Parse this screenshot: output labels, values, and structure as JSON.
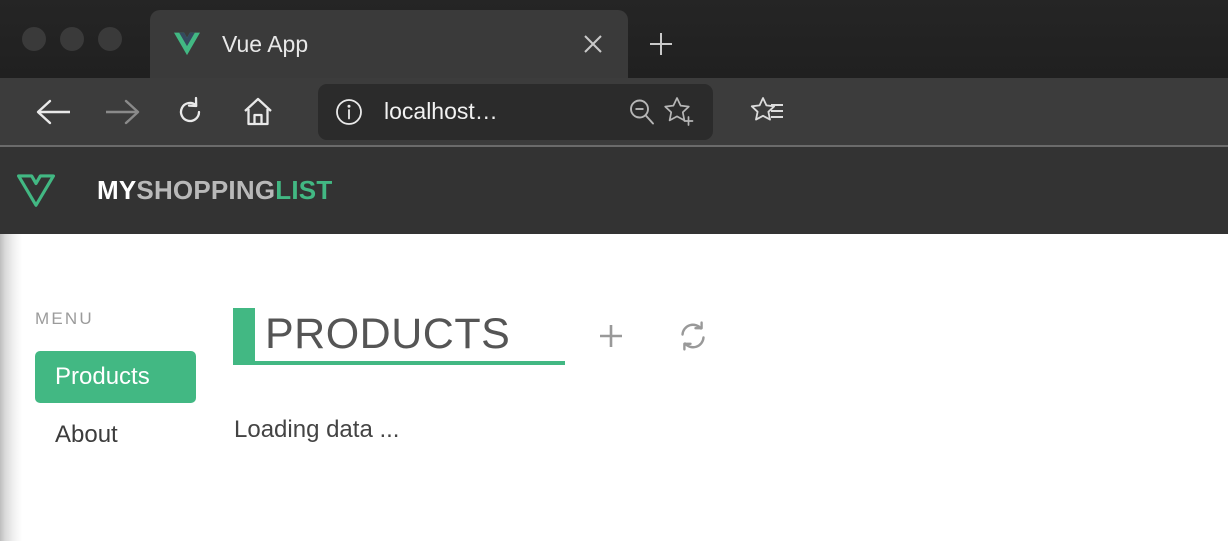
{
  "browser": {
    "window_controls": [
      "close",
      "minimize",
      "maximize"
    ],
    "tab": {
      "title": "Vue App",
      "favicon": "vue-logo-icon",
      "close_label": "×"
    },
    "new_tab_label": "+",
    "toolbar": {
      "back": "back-arrow-icon",
      "forward": "forward-arrow-icon",
      "reload": "reload-icon",
      "home": "home-icon",
      "url_info": "info-circle-icon",
      "url_text": "localhost…",
      "zoom_out": "zoom-out-icon",
      "bookmark_add": "star-plus-icon",
      "reading_list": "reading-list-icon"
    }
  },
  "app": {
    "logo": "vue-logo-icon",
    "brand": {
      "part1": "MY",
      "part2": "SHOPPING",
      "part3": "LIST"
    }
  },
  "sidebar": {
    "heading": "MENU",
    "items": [
      {
        "label": "Products",
        "active": true
      },
      {
        "label": "About",
        "active": false
      }
    ]
  },
  "main": {
    "title": "PRODUCTS",
    "add_label": "+",
    "refresh_label": "refresh-icon",
    "status": "Loading data ..."
  },
  "colors": {
    "accent_green": "#42b883",
    "header_dark": "#333333",
    "toolbar_dark": "#3c3c3c",
    "tabstrip_dark": "#232323"
  }
}
